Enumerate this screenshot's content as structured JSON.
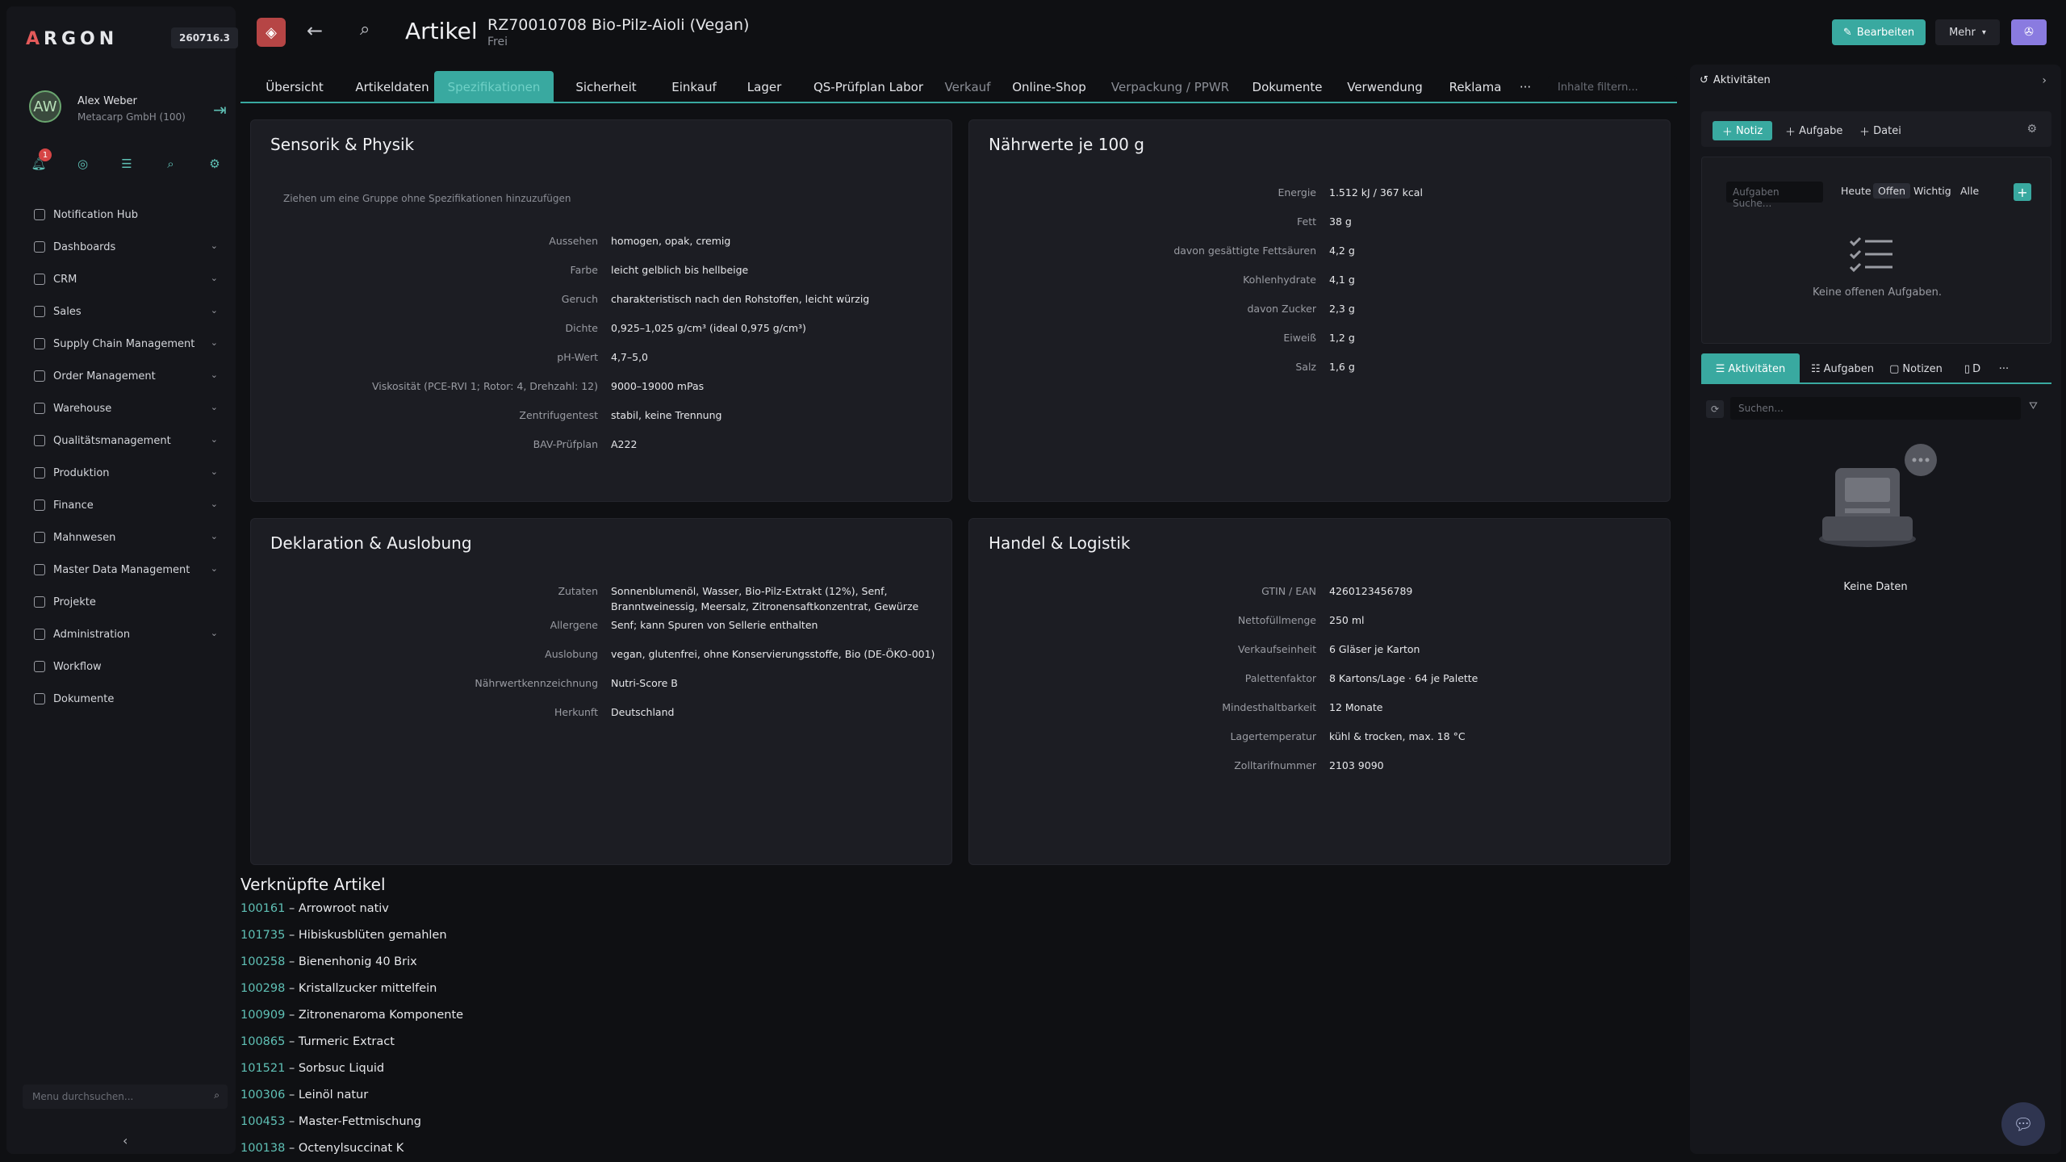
{
  "app": {
    "logo": "ARGON",
    "version": "260716.3"
  },
  "user": {
    "initials": "AW",
    "name": "Alex Weber",
    "company": "Metacarp GmbH (100)"
  },
  "quick": {
    "badge": "1"
  },
  "nav": [
    {
      "label": "Notification Hub",
      "chevron": false
    },
    {
      "label": "Dashboards",
      "chevron": true
    },
    {
      "label": "CRM",
      "chevron": true
    },
    {
      "label": "Sales",
      "chevron": true
    },
    {
      "label": "Supply Chain Management",
      "chevron": true
    },
    {
      "label": "Order Management",
      "chevron": true
    },
    {
      "label": "Warehouse",
      "chevron": true
    },
    {
      "label": "Qualitätsmanagement",
      "chevron": true
    },
    {
      "label": "Produktion",
      "chevron": true
    },
    {
      "label": "Finance",
      "chevron": true
    },
    {
      "label": "Mahnwesen",
      "chevron": true
    },
    {
      "label": "Master Data Management",
      "chevron": true
    },
    {
      "label": "Projekte",
      "chevron": false
    },
    {
      "label": "Administration",
      "chevron": true
    },
    {
      "label": "Workflow",
      "chevron": false
    },
    {
      "label": "Dokumente",
      "chevron": false
    }
  ],
  "menu_search": {
    "placeholder": "Menu durchsuchen..."
  },
  "header": {
    "title": "Artikel",
    "article_id": "RZ70010708 Bio-Pilz-Aioli (Vegan)",
    "status": "Frei",
    "edit": "Bearbeiten",
    "more": "Mehr"
  },
  "tabs": [
    {
      "label": "Übersicht",
      "state": "normal"
    },
    {
      "label": "Artikeldaten",
      "state": "normal"
    },
    {
      "label": "Spezifikationen",
      "state": "active"
    },
    {
      "label": "Sicherheit",
      "state": "normal"
    },
    {
      "label": "Einkauf",
      "state": "normal"
    },
    {
      "label": "Lager",
      "state": "normal"
    },
    {
      "label": "QS-Prüfplan Labor",
      "state": "normal"
    },
    {
      "label": "Verkauf",
      "state": "muted"
    },
    {
      "label": "Online-Shop",
      "state": "normal"
    },
    {
      "label": "Verpackung / PPWR",
      "state": "muted"
    },
    {
      "label": "Dokumente",
      "state": "normal"
    },
    {
      "label": "Verwendung",
      "state": "normal"
    },
    {
      "label": "Reklama",
      "state": "normal"
    }
  ],
  "tab_more": "···",
  "tab_filter": {
    "placeholder": "Inhalte filtern..."
  },
  "sensorik": {
    "title": "Sensorik & Physik",
    "hint": "Ziehen um eine Gruppe ohne Spezifikationen hinzuzufügen",
    "rows": [
      {
        "k": "Aussehen",
        "v": "homogen, opak, cremig"
      },
      {
        "k": "Farbe",
        "v": "leicht gelblich bis hellbeige"
      },
      {
        "k": "Geruch",
        "v": "charakteristisch nach den Rohstoffen, leicht würzig"
      },
      {
        "k": "Dichte",
        "v": "0,925–1,025 g/cm³ (ideal 0,975 g/cm³)"
      },
      {
        "k": "pH-Wert",
        "v": "4,7–5,0"
      },
      {
        "k": "Viskosität (PCE-RVI 1; Rotor: 4, Drehzahl: 12)",
        "v": "9000–19000 mPas"
      },
      {
        "k": "Zentrifugentest",
        "v": "stabil, keine Trennung"
      },
      {
        "k": "BAV-Prüfplan",
        "v": "A222"
      }
    ]
  },
  "naehrwerte": {
    "title": "Nährwerte je 100 g",
    "rows": [
      {
        "k": "Energie",
        "v": "1.512 kJ / 367 kcal"
      },
      {
        "k": "Fett",
        "v": "38 g"
      },
      {
        "k": "davon gesättigte Fettsäuren",
        "v": "4,2 g"
      },
      {
        "k": "Kohlenhydrate",
        "v": "4,1 g"
      },
      {
        "k": "davon Zucker",
        "v": "2,3 g"
      },
      {
        "k": "Eiweiß",
        "v": "1,2 g"
      },
      {
        "k": "Salz",
        "v": "1,6 g"
      }
    ]
  },
  "deklaration": {
    "title": "Deklaration & Auslobung",
    "rows": [
      {
        "k": "Zutaten",
        "v": "Sonnenblumenöl, Wasser, Bio-Pilz-Extrakt (12%), Senf,",
        "v2": "Branntweinessig, Meersalz, Zitronensaftkonzentrat, Gewürze"
      },
      {
        "k": "Allergene",
        "v": "Senf; kann Spuren von Sellerie enthalten"
      },
      {
        "k": "Auslobung",
        "v": "vegan, glutenfrei, ohne Konservierungsstoffe, Bio (DE-ÖKO-001)"
      },
      {
        "k": "Nährwertkennzeichnung",
        "v": "Nutri-Score B"
      },
      {
        "k": "Herkunft",
        "v": "Deutschland"
      }
    ]
  },
  "handel": {
    "title": "Handel & Logistik",
    "rows": [
      {
        "k": "GTIN / EAN",
        "v": "4260123456789"
      },
      {
        "k": "Nettofüllmenge",
        "v": "250 ml"
      },
      {
        "k": "Verkaufseinheit",
        "v": "6 Gläser je Karton"
      },
      {
        "k": "Palettenfaktor",
        "v": "8 Kartons/Lage · 64 je Palette"
      },
      {
        "k": "Mindesthaltbarkeit",
        "v": "12 Monate"
      },
      {
        "k": "Lagertemperatur",
        "v": "kühl & trocken, max. 18 °C"
      },
      {
        "k": "Zolltarifnummer",
        "v": "2103 9090"
      }
    ]
  },
  "linked": {
    "title": "Verknüpfte Artikel",
    "items": [
      {
        "n": "100161",
        "t": " – Arrowroot nativ"
      },
      {
        "n": "101735",
        "t": " – Hibiskusblüten gemahlen"
      },
      {
        "n": "100258",
        "t": " – Bienenhonig 40 Brix"
      },
      {
        "n": "100298",
        "t": " – Kristallzucker mittelfein"
      },
      {
        "n": "100909",
        "t": " – Zitronenaroma Komponente"
      },
      {
        "n": "100865",
        "t": " – Turmeric Extract"
      },
      {
        "n": "101521",
        "t": " – Sorbsuc Liquid"
      },
      {
        "n": "100306",
        "t": " – Leinöl natur"
      },
      {
        "n": "100453",
        "t": " – Master-Fettmischung"
      },
      {
        "n": "100138",
        "t": " – Octenylsuccinat K"
      }
    ]
  },
  "panel": {
    "title": "Aktivitäten",
    "note": "Notiz",
    "task": "Aufgabe",
    "file": "Datei",
    "task_search": "Aufgaben Suche...",
    "filters": [
      "Heute",
      "Offen",
      "Wichtig",
      "Alle"
    ],
    "empty_tasks": "Keine offenen Aufgaben.",
    "tabs": [
      "Aktivitäten",
      "Aufgaben",
      "Notizen",
      "D"
    ],
    "search": "Suchen...",
    "no_data": "Keine Daten"
  }
}
